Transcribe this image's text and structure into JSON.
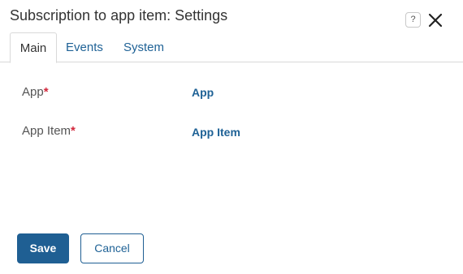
{
  "dialog": {
    "title": "Subscription to app item: Settings",
    "help_glyph": "?"
  },
  "tabs": [
    {
      "label": "Main",
      "active": true
    },
    {
      "label": "Events",
      "active": false
    },
    {
      "label": "System",
      "active": false
    }
  ],
  "fields": [
    {
      "label": "App",
      "required_mark": "*",
      "value": "App"
    },
    {
      "label": "App Item",
      "required_mark": "*",
      "value": "App Item"
    }
  ],
  "buttons": {
    "save_label": "Save",
    "cancel_label": "Cancel"
  },
  "colors": {
    "accent": "#1f5f93",
    "link": "#1f6296",
    "required": "#d2283c"
  },
  "icons": {
    "help": "help-icon",
    "close": "close-icon"
  }
}
